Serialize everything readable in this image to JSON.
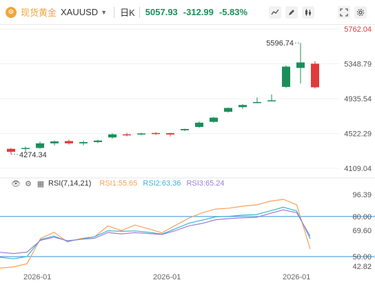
{
  "header": {
    "symbol_icon": "gold-coin-icon",
    "symbol_icon_glyph": "⊙",
    "symbol_name": "现货黄金",
    "symbol_code": "XAUUSD",
    "period": "日K",
    "price": "5057.93",
    "change": "-312.99",
    "change_pct": "-5.83%",
    "color_accent": "#f0a63a",
    "color_down": "#1a8f5a",
    "color_up": "#e03a3a"
  },
  "rsi_legend": {
    "name": "RSI(7,14,21)",
    "rsi1": "RSI1:55.65",
    "rsi2": "RSI2:63.36",
    "rsi3": "RSI3:65.24"
  },
  "x_dates": [
    "2026-01",
    "2026-01",
    "2026-01"
  ],
  "chart_data": [
    {
      "type": "candlestick",
      "title": "",
      "y_ticks": [
        "5762.04",
        "5348.79",
        "4935.54",
        "4522.29",
        "4109.04"
      ],
      "ylim": [
        4109.04,
        5762.04
      ],
      "annotations": {
        "high_label": "5596.74",
        "low_label": "4274.34"
      },
      "candles": [
        {
          "o": 4340,
          "h": 4350,
          "l": 4274.34,
          "c": 4305
        },
        {
          "o": 4345,
          "h": 4368,
          "l": 4300,
          "c": 4350
        },
        {
          "o": 4350,
          "h": 4425,
          "l": 4340,
          "c": 4405
        },
        {
          "o": 4405,
          "h": 4440,
          "l": 4380,
          "c": 4428
        },
        {
          "o": 4432,
          "h": 4450,
          "l": 4390,
          "c": 4405
        },
        {
          "o": 4405,
          "h": 4438,
          "l": 4380,
          "c": 4420
        },
        {
          "o": 4420,
          "h": 4448,
          "l": 4408,
          "c": 4438
        },
        {
          "o": 4475,
          "h": 4525,
          "l": 4460,
          "c": 4512
        },
        {
          "o": 4512,
          "h": 4530,
          "l": 4488,
          "c": 4500
        },
        {
          "o": 4512,
          "h": 4530,
          "l": 4500,
          "c": 4522
        },
        {
          "o": 4528,
          "h": 4538,
          "l": 4505,
          "c": 4515
        },
        {
          "o": 4525,
          "h": 4530,
          "l": 4488,
          "c": 4510
        },
        {
          "o": 4560,
          "h": 4580,
          "l": 4550,
          "c": 4575
        },
        {
          "o": 4600,
          "h": 4665,
          "l": 4590,
          "c": 4650
        },
        {
          "o": 4660,
          "h": 4720,
          "l": 4650,
          "c": 4710
        },
        {
          "o": 4780,
          "h": 4830,
          "l": 4770,
          "c": 4825
        },
        {
          "o": 4835,
          "h": 4870,
          "l": 4815,
          "c": 4860
        },
        {
          "o": 4885,
          "h": 4950,
          "l": 4880,
          "c": 4895
        },
        {
          "o": 4905,
          "h": 4985,
          "l": 4905,
          "c": 4915
        },
        {
          "o": 5075,
          "h": 5330,
          "l": 5065,
          "c": 5315
        },
        {
          "o": 5300,
          "h": 5596.74,
          "l": 5115,
          "c": 5365
        },
        {
          "o": 5350,
          "h": 5380,
          "l": 5055,
          "c": 5070
        }
      ]
    },
    {
      "type": "line",
      "title": "RSI(7,14,21)",
      "y_ticks": [
        "96.39",
        "80.00",
        "69.60",
        "50.00",
        "42.82"
      ],
      "ylim": [
        42.82,
        96.39
      ],
      "reference_lines": [
        80.0,
        50.0
      ],
      "series": [
        {
          "name": "RSI1",
          "color": "#f5a15c",
          "values": [
            41.5,
            42.3,
            44.6,
            63.4,
            68.2,
            60.9,
            63.6,
            64.8,
            72.9,
            69.5,
            73.6,
            70.8,
            67.8,
            73.3,
            78.7,
            82.8,
            85.5,
            86.2,
            87.7,
            88.6,
            91.3,
            92.8,
            88.7,
            55.65
          ]
        },
        {
          "name": "RSI2",
          "color": "#3ab3d8",
          "values": [
            49.5,
            48.4,
            50.1,
            62.7,
            65.4,
            61.5,
            63.0,
            64.8,
            69.3,
            68.9,
            69.2,
            68.2,
            66.8,
            70.8,
            74.9,
            77.3,
            79.7,
            80.1,
            81.0,
            81.4,
            84.1,
            86.9,
            84.1,
            63.36
          ]
        },
        {
          "name": "RSI3",
          "color": "#9b7fd2",
          "values": [
            53.2,
            52.3,
            53.4,
            62.1,
            64.5,
            61.9,
            62.9,
            63.7,
            68.0,
            67.0,
            67.9,
            67.3,
            66.5,
            69.4,
            73.0,
            74.8,
            77.6,
            78.4,
            79.0,
            79.3,
            82.2,
            84.9,
            82.8,
            65.24
          ]
        }
      ]
    }
  ]
}
